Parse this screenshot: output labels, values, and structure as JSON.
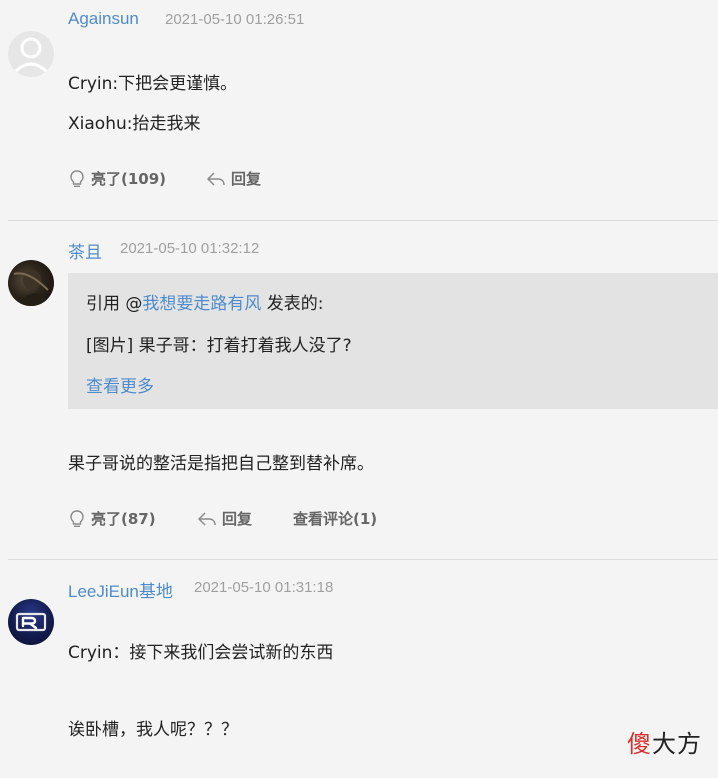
{
  "comments": [
    {
      "author": "Againsun",
      "time": "2021-05-10 01:26:51",
      "lines": [
        "Cryin:下把会更谨慎。",
        "Xiaohu:抬走我来"
      ],
      "like_label": "亮了(109)",
      "reply_label": "回复"
    },
    {
      "author": "茶且",
      "time": "2021-05-10 01:32:12",
      "quote": {
        "prefix": "引用 @",
        "user": "我想要走路有风",
        "suffix": " 发表的:",
        "text": "[图片] 果子哥：打着打着我人没了?",
        "more": "查看更多"
      },
      "lines": [
        "果子哥说的整活是指把自己整到替补席。"
      ],
      "like_label": "亮了(87)",
      "reply_label": "回复",
      "view_replies_label": "查看评论(1)"
    },
    {
      "author": "LeeJiEun基地",
      "time": "2021-05-10 01:31:18",
      "lines": [
        "Cryin：接下来我们会尝试新的东西",
        "诶卧槽，我人呢？？？"
      ]
    }
  ],
  "watermark": {
    "accent": "傻",
    "rest": "大方"
  },
  "icons": {
    "like": "lightbulb-icon",
    "reply": "reply-arrow-icon",
    "avatar_default": "user-silhouette-icon"
  },
  "colors": {
    "link": "#4e8ccd",
    "quote_bg": "#e3e3e3",
    "time": "#a0a0a0",
    "watermark_accent": "#d8302b"
  }
}
